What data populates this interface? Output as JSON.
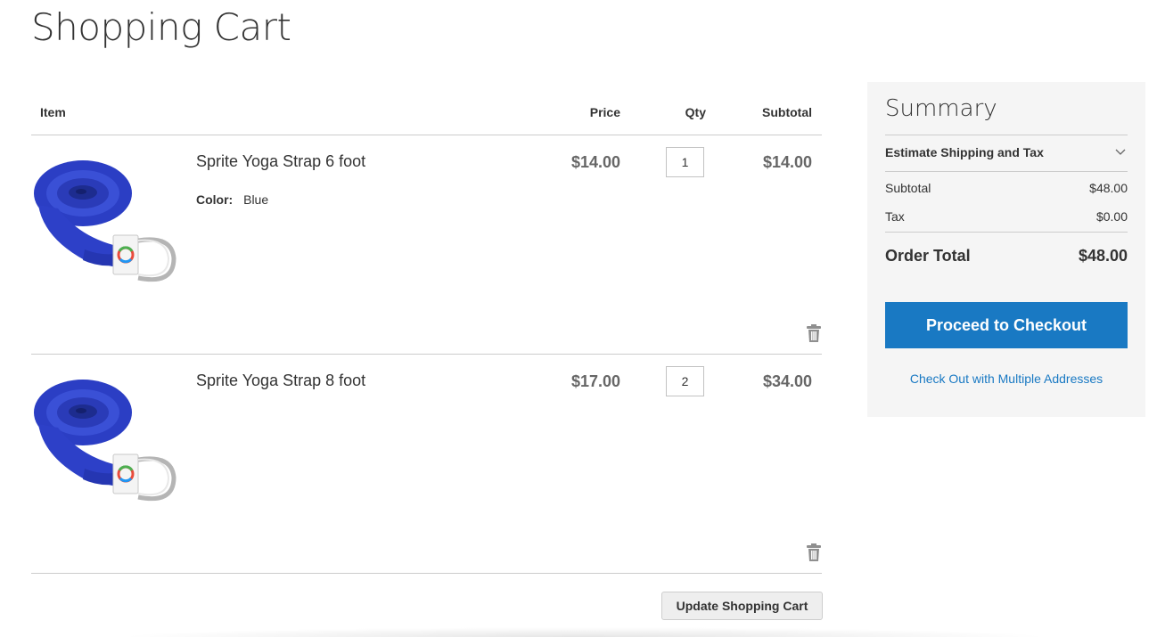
{
  "page": {
    "title": "Shopping Cart"
  },
  "cart": {
    "headers": {
      "item": "Item",
      "price": "Price",
      "qty": "Qty",
      "subtotal": "Subtotal"
    },
    "items": [
      {
        "name": "Sprite Yoga Strap 6 foot",
        "option_label": "Color:",
        "option_value": "Blue",
        "price": "$14.00",
        "qty": "1",
        "subtotal": "$14.00",
        "image_icon": "yoga-strap-icon",
        "delete_icon": "trash-icon"
      },
      {
        "name": "Sprite Yoga Strap 8 foot",
        "price": "$17.00",
        "qty": "2",
        "subtotal": "$34.00",
        "image_icon": "yoga-strap-icon",
        "delete_icon": "trash-icon"
      }
    ],
    "update_button": "Update Shopping Cart"
  },
  "summary": {
    "title": "Summary",
    "estimate_label": "Estimate Shipping and Tax",
    "estimate_icon": "chevron-down-icon",
    "subtotal_label": "Subtotal",
    "subtotal_value": "$48.00",
    "tax_label": "Tax",
    "tax_value": "$0.00",
    "order_total_label": "Order Total",
    "order_total_value": "$48.00",
    "checkout_button": "Proceed to Checkout",
    "multi_address_link": "Check Out with Multiple Addresses"
  },
  "colors": {
    "accent": "#1979c3",
    "strap_blue": "#2a3fc7",
    "summary_bg": "#f5f5f5",
    "price_text": "#666666"
  }
}
